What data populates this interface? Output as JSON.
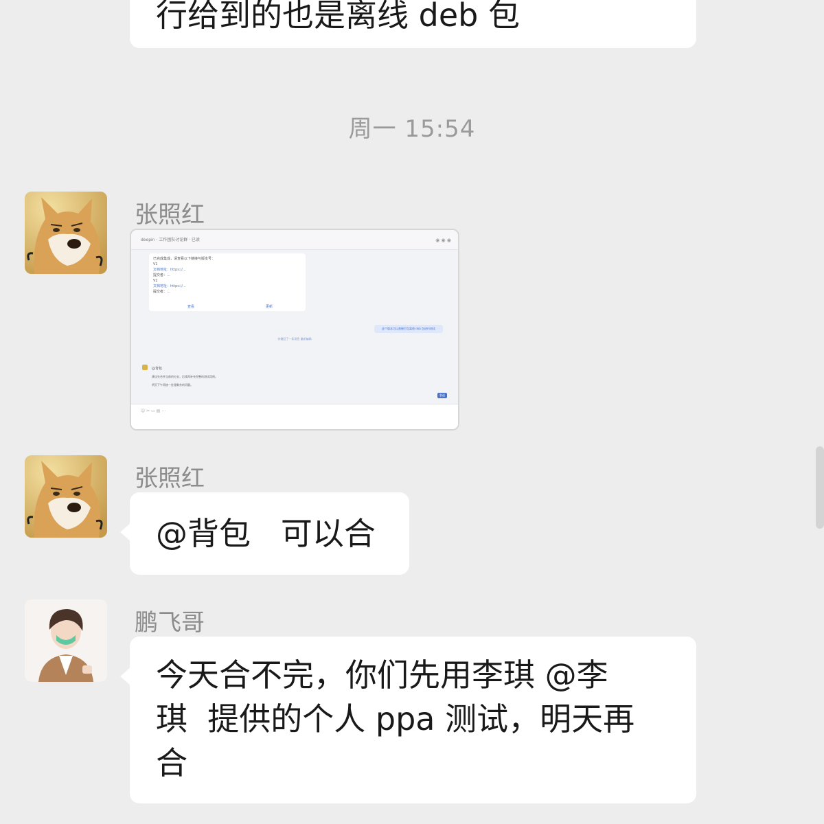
{
  "messages": [
    {
      "type": "text-partial",
      "text": "行给到的也是离线 deb 包"
    },
    {
      "type": "timestamp",
      "text": "周一 15:54"
    },
    {
      "type": "image",
      "sender": "张照红",
      "avatar": "doge-avatar",
      "preview": {
        "toolbar_title": "deepin · 工作团队讨论群 · 已读",
        "quoted_lines": [
          "已完成集成，请查看以下链接与版本号：",
          "V1",
          "文档地址：https://…",
          "提交者：…",
          "V2",
          "文档地址：https://…",
          "提交者：…"
        ],
        "link_a": "查看",
        "link_b": "更新",
        "right_bubble": "这个版本可以直接打包离线 deb 包进行测试",
        "center_note": "你撤回了一条消息 重新编辑",
        "reply_lines": [
          "@背包",
          "建议先合并当前的分支，后续再补充完整的测试用例。",
          "明天下午再统一处理剩余的问题。"
        ],
        "send_btn": "发送"
      }
    },
    {
      "type": "text",
      "sender": "张照红",
      "avatar": "doge-avatar",
      "text": "@背包   可以合"
    },
    {
      "type": "text",
      "sender": "鹏飞哥",
      "avatar": "anime-avatar",
      "lines": [
        "今天合不完，你们先用李琪 @李",
        "琪  提供的个人 ppa 测试，明天再",
        "合"
      ]
    }
  ],
  "colors": {
    "background": "#ededed",
    "bubble": "#ffffff",
    "name": "#8c8c8c",
    "time": "#9a9a9a"
  }
}
